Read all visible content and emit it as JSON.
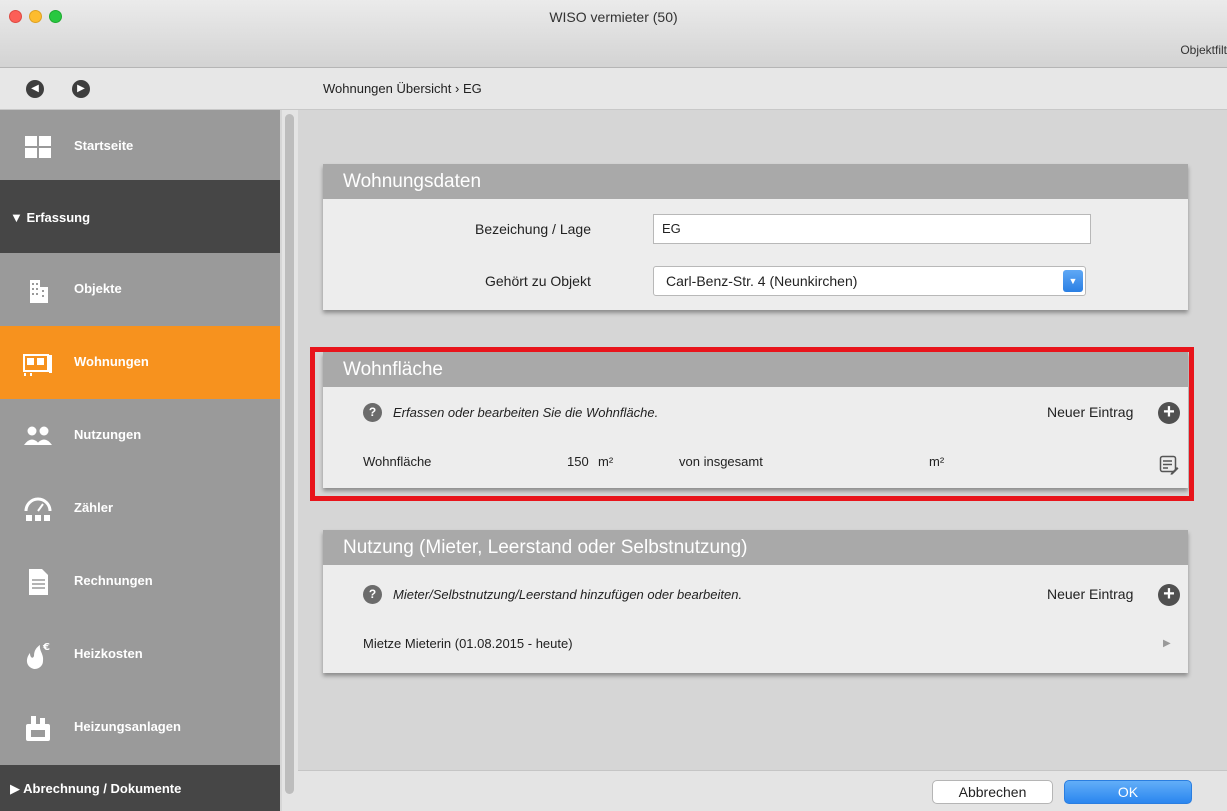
{
  "window": {
    "title": "WISO vermieter (50)",
    "filter_label": "Objektfilt"
  },
  "nav": {
    "breadcrumb": "Wohnungen Übersicht › EG",
    "back_icon": "arrow-left-icon",
    "forward_icon": "arrow-right-icon"
  },
  "sidebar": {
    "items": [
      {
        "label": "Startseite",
        "icon": "grid-icon"
      },
      {
        "label": "Objekte",
        "icon": "building-icon"
      },
      {
        "label": "Wohnungen",
        "icon": "apartment-icon",
        "active": true
      },
      {
        "label": "Nutzungen",
        "icon": "people-icon"
      },
      {
        "label": "Zähler",
        "icon": "meter-icon"
      },
      {
        "label": "Rechnungen",
        "icon": "document-icon"
      },
      {
        "label": "Heizkosten",
        "icon": "flame-euro-icon"
      },
      {
        "label": "Heizungsanlagen",
        "icon": "heater-icon"
      }
    ],
    "sections": {
      "erfassung": "Erfassung",
      "abrechnung": "Abrechnung / Dokumente"
    }
  },
  "wohnungsdaten": {
    "title": "Wohnungsdaten",
    "bezeichnung_label": "Bezeichung / Lage",
    "bezeichnung_value": "EG",
    "objekt_label": "Gehört zu Objekt",
    "objekt_value": "Carl-Benz-Str. 4 (Neunkirchen)"
  },
  "wohnflaeche": {
    "title": "Wohnfläche",
    "hint": "Erfassen oder bearbeiten Sie die Wohnfläche.",
    "new_entry": "Neuer Eintrag",
    "row_label": "Wohnfläche",
    "value": "150",
    "unit": "m²",
    "total_label": "von insgesamt",
    "total_unit": "m²"
  },
  "nutzung": {
    "title": "Nutzung (Mieter, Leerstand oder Selbstnutzung)",
    "hint": "Mieter/Selbstnutzung/Leerstand hinzufügen oder bearbeiten.",
    "new_entry": "Neuer Eintrag",
    "row": "Mietze Mieterin (01.08.2015 - heute)"
  },
  "footer": {
    "cancel": "Abbrechen",
    "ok": "OK"
  },
  "colors": {
    "accent": "#f7921e",
    "highlight": "#e8141b",
    "primary_button": "#2a86ef"
  }
}
